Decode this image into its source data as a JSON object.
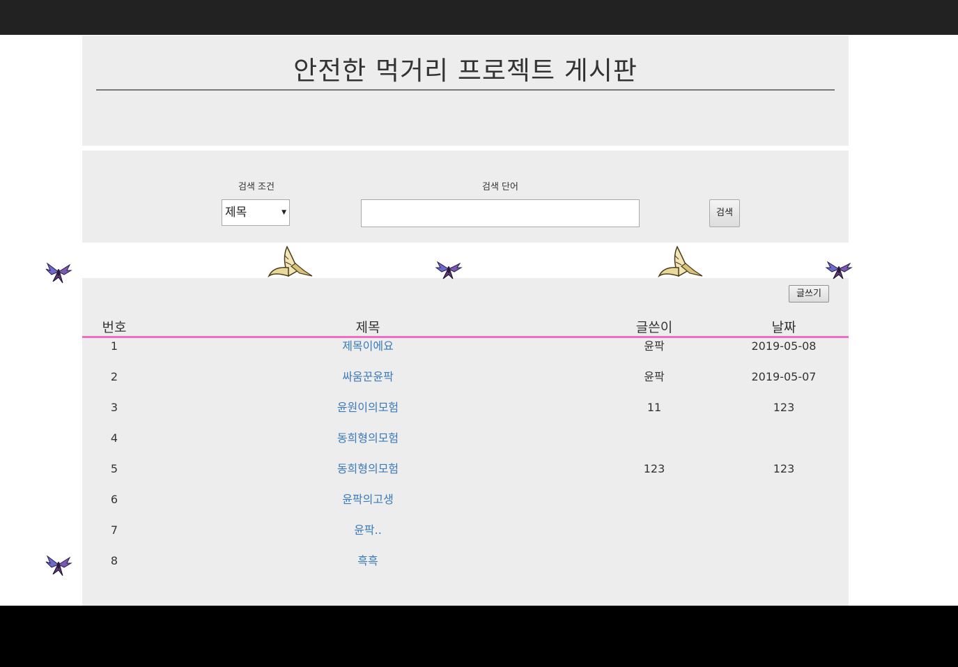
{
  "board": {
    "title": "안전한 먹거리 프로젝트 게시판"
  },
  "search": {
    "condition_label": "검색 조건",
    "condition_value": "제목",
    "keyword_label": "검색 단어",
    "keyword_value": "",
    "button_label": "검색"
  },
  "toolbar": {
    "write_label": "글쓰기"
  },
  "table": {
    "headers": {
      "no": "번호",
      "title": "제목",
      "author": "글쓴이",
      "date": "날짜"
    },
    "rows": [
      {
        "no": "1",
        "title": "제목이에요",
        "author": "윤팍",
        "date": "2019-05-08"
      },
      {
        "no": "2",
        "title": "싸움꾼윤팍",
        "author": "윤팍",
        "date": "2019-05-07"
      },
      {
        "no": "3",
        "title": "윤원이의모험",
        "author": "11",
        "date": "123"
      },
      {
        "no": "4",
        "title": "동희형의모험",
        "author": "",
        "date": ""
      },
      {
        "no": "5",
        "title": "동희형의모험",
        "author": "123",
        "date": "123"
      },
      {
        "no": "6",
        "title": "윤팍의고생",
        "author": "",
        "date": ""
      },
      {
        "no": "7",
        "title": "윤팍..",
        "author": "",
        "date": ""
      },
      {
        "no": "8",
        "title": "흑흑",
        "author": "",
        "date": ""
      }
    ]
  },
  "colors": {
    "topbar": "#222222",
    "panel": "#ededed",
    "header_rule": "#ee6ec2",
    "link": "#3a7ab7"
  },
  "decorations": {
    "icons": [
      "butterfly-icon",
      "swallowtail-icon"
    ]
  }
}
